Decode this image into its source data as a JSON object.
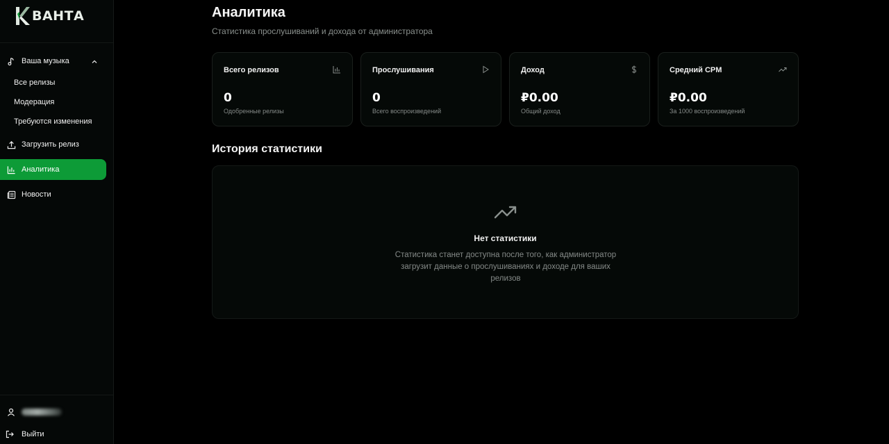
{
  "brand": {
    "name": "ВАНТА",
    "accent": "#0d9b37"
  },
  "sidebar": {
    "music_section": {
      "label": "Ваша музыка",
      "icon": "music-note-icon"
    },
    "music_items": [
      {
        "label": "Все релизы"
      },
      {
        "label": "Модерация"
      },
      {
        "label": "Требуются изменения"
      }
    ],
    "upload": {
      "label": "Загрузить релиз",
      "icon": "upload-icon"
    },
    "analytics": {
      "label": "Аналитика",
      "icon": "bar-chart-icon"
    },
    "news": {
      "label": "Новости",
      "icon": "newspaper-icon"
    },
    "logout": {
      "label": "Выйти",
      "icon": "logout-icon"
    }
  },
  "main": {
    "title": "Аналитика",
    "subtitle": "Статистика прослушиваний и дохода от администратора",
    "cards": [
      {
        "title": "Всего релизов",
        "value": "0",
        "note": "Одобренные релизы",
        "icon": "bar-chart-icon"
      },
      {
        "title": "Прослушивания",
        "value": "0",
        "note": "Всего воспроизведений",
        "icon": "play-icon"
      },
      {
        "title": "Доход",
        "value": "₽0.00",
        "note": "Общий доход",
        "icon": "dollar-icon"
      },
      {
        "title": "Средний CPM",
        "value": "₽0.00",
        "note": "За 1000 воспроизведений",
        "icon": "trending-up-icon"
      }
    ],
    "history": {
      "title": "История статистики",
      "empty_title": "Нет статистики",
      "empty_desc": "Статистика станет доступна после того, как администратор загрузит данные о прослушиваниях и доходе для ваших релизов"
    }
  }
}
